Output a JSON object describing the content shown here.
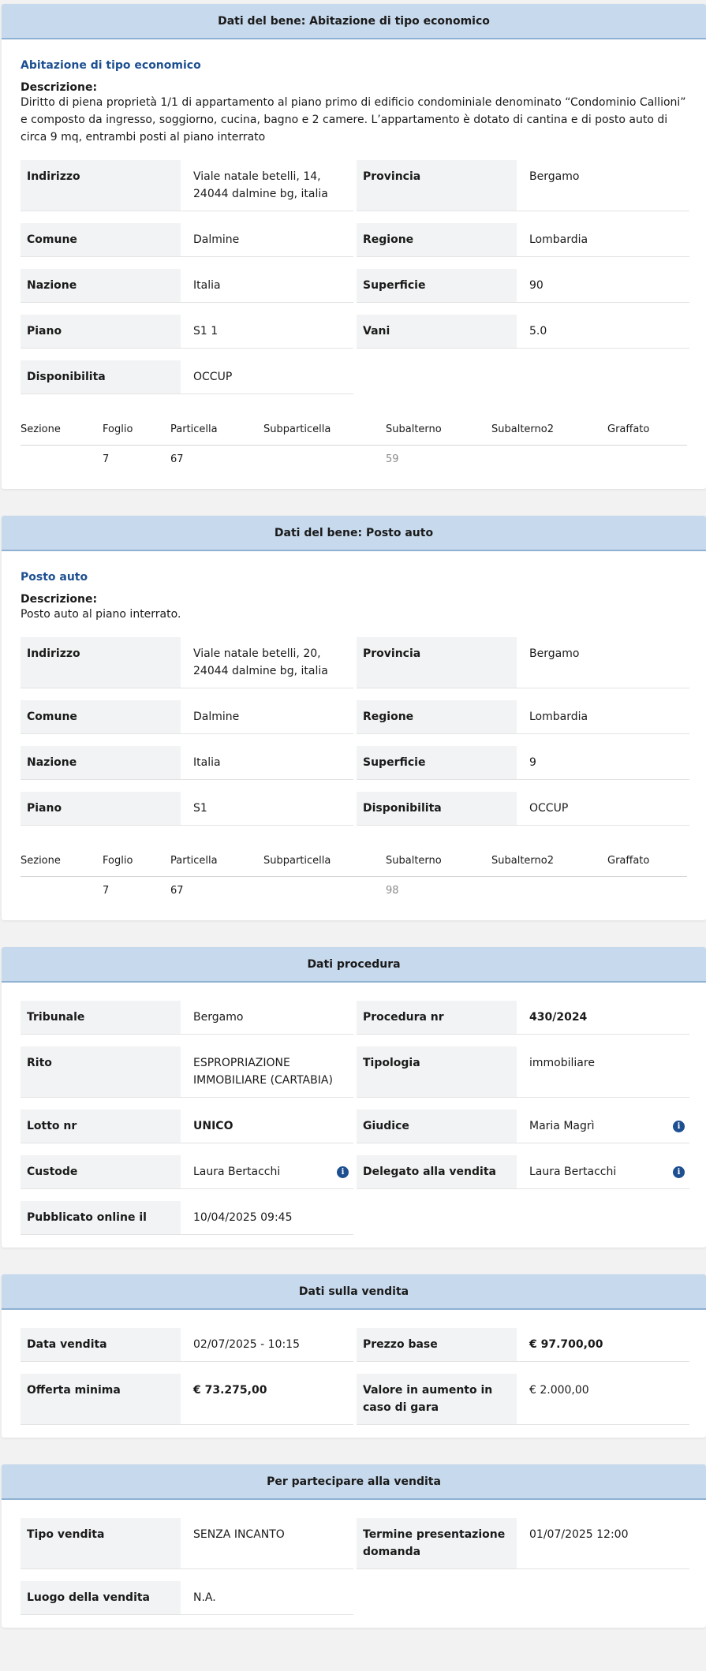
{
  "bene1": {
    "header": "Dati del bene: Abitazione di tipo economico",
    "title": "Abitazione di tipo economico",
    "desc_label": "Descrizione:",
    "desc_text": "Diritto di piena proprietà 1/1 di appartamento al piano primo di edificio condominiale denominato “Condominio Callioni” e composto da ingresso, soggiorno, cucina, bagno e 2 camere. L’appartamento è dotato di cantina e di posto auto di circa 9 mq, entrambi posti al piano interrato",
    "fields": [
      {
        "label": "Indirizzo",
        "value": "Viale natale betelli, 14, 24044 dalmine bg, italia"
      },
      {
        "label": "Provincia",
        "value": "Bergamo"
      },
      {
        "label": "Comune",
        "value": "Dalmine"
      },
      {
        "label": "Regione",
        "value": "Lombardia"
      },
      {
        "label": "Nazione",
        "value": "Italia"
      },
      {
        "label": "Superficie",
        "value": "90"
      },
      {
        "label": "Piano",
        "value": "S1 1"
      },
      {
        "label": "Vani",
        "value": "5.0"
      },
      {
        "label": "Disponibilita",
        "value": "OCCUP"
      }
    ],
    "cad_headers": [
      "Sezione",
      "Foglio",
      "Particella",
      "Subparticella",
      "Subalterno",
      "Subalterno2",
      "Graffato"
    ],
    "cad_row": [
      "",
      "7",
      "67",
      "",
      "59",
      "",
      ""
    ]
  },
  "bene2": {
    "header": "Dati del bene: Posto auto",
    "title": "Posto auto",
    "desc_label": "Descrizione:",
    "desc_text": "Posto auto al piano interrato.",
    "fields": [
      {
        "label": "Indirizzo",
        "value": "Viale natale betelli, 20, 24044 dalmine bg, italia"
      },
      {
        "label": "Provincia",
        "value": "Bergamo"
      },
      {
        "label": "Comune",
        "value": "Dalmine"
      },
      {
        "label": "Regione",
        "value": "Lombardia"
      },
      {
        "label": "Nazione",
        "value": "Italia"
      },
      {
        "label": "Superficie",
        "value": "9"
      },
      {
        "label": "Piano",
        "value": "S1"
      },
      {
        "label": "Disponibilita",
        "value": "OCCUP"
      }
    ],
    "cad_headers": [
      "Sezione",
      "Foglio",
      "Particella",
      "Subparticella",
      "Subalterno",
      "Subalterno2",
      "Graffato"
    ],
    "cad_row": [
      "",
      "7",
      "67",
      "",
      "98",
      "",
      ""
    ]
  },
  "procedura": {
    "header": "Dati procedura",
    "fields": [
      {
        "label": "Tribunale",
        "value": "Bergamo"
      },
      {
        "label": "Procedura nr",
        "value": "430/2024"
      },
      {
        "label": "Rito",
        "value": "ESPROPRIAZIONE IMMOBILIARE (CARTABIA)"
      },
      {
        "label": "Tipologia",
        "value": "immobiliare"
      },
      {
        "label": "Lotto nr",
        "value": "UNICO"
      },
      {
        "label": "Giudice",
        "value": "Maria Magrì"
      },
      {
        "label": "Custode",
        "value": "Laura Bertacchi"
      },
      {
        "label": "Delegato alla vendita",
        "value": "Laura Bertacchi"
      },
      {
        "label": "Pubblicato online il",
        "value": "10/04/2025 09:45"
      }
    ]
  },
  "vendita": {
    "header": "Dati sulla vendita",
    "fields": [
      {
        "label": "Data vendita",
        "value": "02/07/2025 - 10:15"
      },
      {
        "label": "Prezzo base",
        "value": "€ 97.700,00"
      },
      {
        "label": "Offerta minima",
        "value": "€ 73.275,00"
      },
      {
        "label": "Valore in aumento in caso di gara",
        "value": "€ 2.000,00"
      }
    ]
  },
  "partecipare": {
    "header": "Per partecipare alla vendita",
    "fields": [
      {
        "label": "Tipo vendita",
        "value": "SENZA INCANTO"
      },
      {
        "label": "Termine presentazione domanda",
        "value": "01/07/2025 12:00"
      },
      {
        "label": "Luogo della vendita",
        "value": "N.A."
      }
    ]
  },
  "icons": {
    "info": "info-icon",
    "info_glyph": "i"
  },
  "colors": {
    "header_bg": "#c7d9ec",
    "accent": "#1d4f91"
  }
}
